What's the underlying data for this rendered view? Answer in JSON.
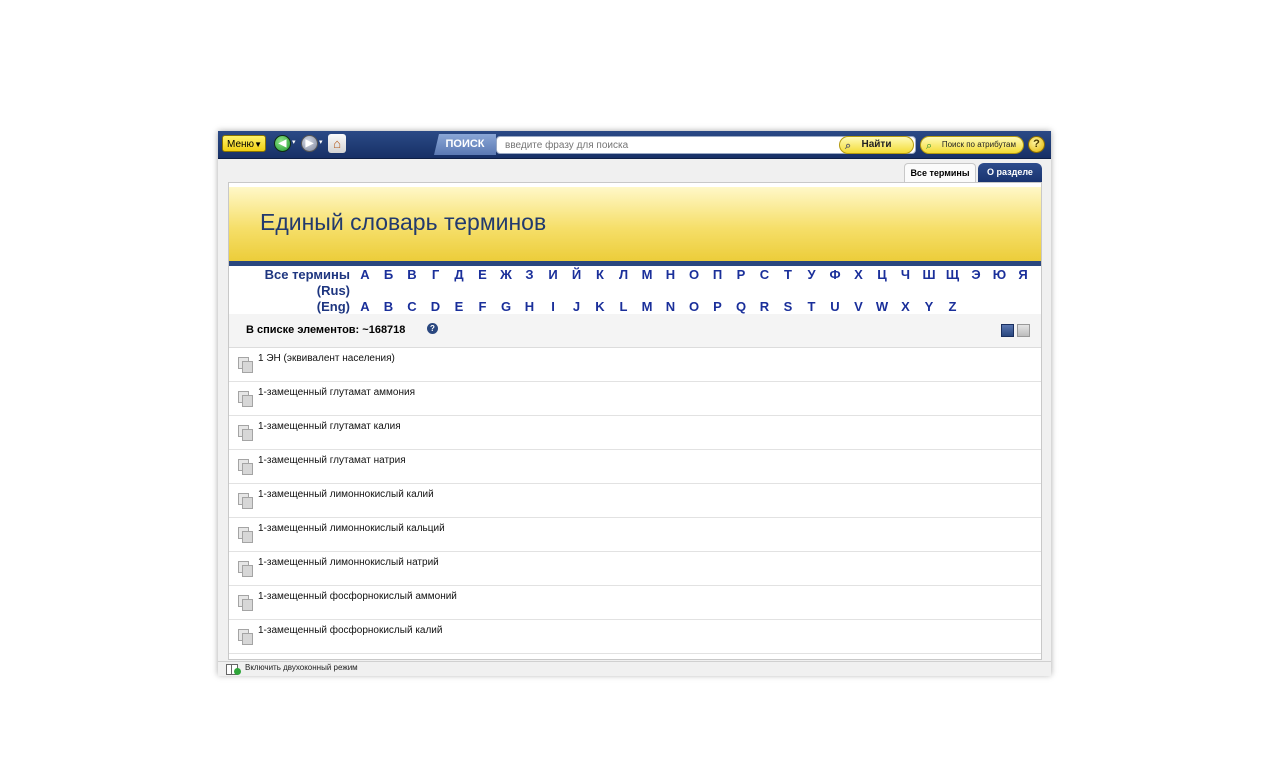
{
  "toolbar": {
    "menu_label": "Меню",
    "search_tab_label": "ПОИСК",
    "search_placeholder": "введите фразу для поиска",
    "find_label": "Найти",
    "attr_search_label": "Поиск по атрибутам",
    "help_label": "?"
  },
  "tabs": [
    {
      "label": "Все термины",
      "active": true
    },
    {
      "label": "О разделе",
      "active": false
    }
  ],
  "banner": {
    "title": "Единый словарь терминов"
  },
  "alphabet": {
    "rus_label_line1": "Все термины",
    "rus_label_line2": "(Rus)",
    "eng_label": "(Eng)",
    "rus_letters": [
      "А",
      "Б",
      "В",
      "Г",
      "Д",
      "Е",
      "Ж",
      "З",
      "И",
      "Й",
      "К",
      "Л",
      "М",
      "Н",
      "О",
      "П",
      "Р",
      "С",
      "Т",
      "У",
      "Ф",
      "Х",
      "Ц",
      "Ч",
      "Ш",
      "Щ",
      "Э",
      "Ю",
      "Я"
    ],
    "eng_letters": [
      "A",
      "B",
      "C",
      "D",
      "E",
      "F",
      "G",
      "H",
      "I",
      "J",
      "K",
      "L",
      "M",
      "N",
      "O",
      "P",
      "Q",
      "R",
      "S",
      "T",
      "U",
      "V",
      "W",
      "X",
      "Y",
      "Z"
    ]
  },
  "list": {
    "count_text": "В списке элементов: ~168718",
    "help": "?",
    "items": [
      "1 ЭН (эквивалент населения)",
      "1-замещенный глутамат аммония",
      "1-замещенный глутамат калия",
      "1-замещенный глутамат натрия",
      "1-замещенный лимоннокислый калий",
      "1-замещенный лимоннокислый кальций",
      "1-замещенный лимоннокислый натрий",
      "1-замещенный фосфорнокислый аммоний",
      "1-замещенный фосфорнокислый калий"
    ]
  },
  "footer": {
    "dual_window_label": "Включить двухоконный режим"
  },
  "colors": {
    "accent_blue": "#2a477f",
    "banner_yellow": "#f6df6a",
    "button_yellow": "#f3db35"
  }
}
